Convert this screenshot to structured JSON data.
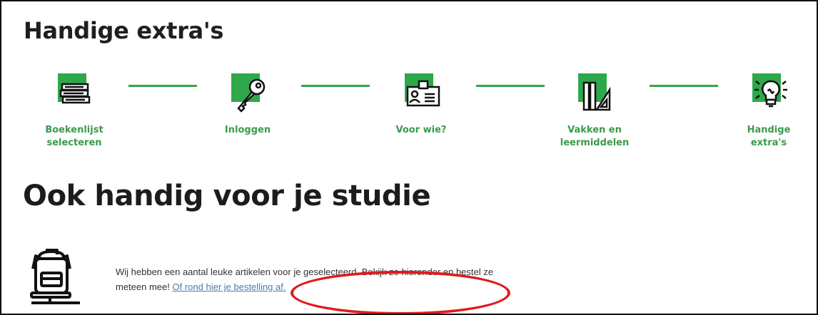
{
  "section_title": "Handige extra's",
  "steps": [
    {
      "label": "Boekenlijst selecteren",
      "icon": "book-stack-icon"
    },
    {
      "label": "Inloggen",
      "icon": "key-icon"
    },
    {
      "label": "Voor wie?",
      "icon": "id-card-icon"
    },
    {
      "label": "Vakken en leermiddelen",
      "icon": "books-ruler-icon"
    },
    {
      "label": "Handige extra's",
      "icon": "lightbulb-icon"
    }
  ],
  "heading": "Ook handig voor je studie",
  "info": {
    "text": "Wij hebben een aantal leuke artikelen voor je geselecteerd. Bekijk ze hieronder en bestel ze meteen mee!",
    "link": "Of rond hier je bestelling af.",
    "icon": "backpack-icon"
  },
  "colors": {
    "accent_green": "#2ea84a",
    "label_green": "#3a9a4b",
    "link_blue": "#4a7bb0",
    "annotation_red": "#e0191c"
  }
}
